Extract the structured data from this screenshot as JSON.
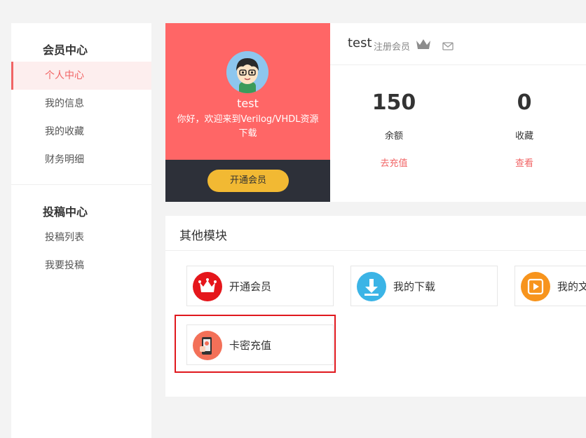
{
  "sidebar": {
    "member_center_title": "会员中心",
    "member_items": [
      "个人中心",
      "我的信息",
      "我的收藏",
      "财务明细"
    ],
    "submission_center_title": "投稿中心",
    "submission_items": [
      "投稿列表",
      "我要投稿"
    ]
  },
  "profile": {
    "name": "test",
    "welcome": "你好，欢迎来到Verilog/VHDL资源下载",
    "vip_button": "开通会员"
  },
  "stats": {
    "username": "test",
    "level": "注册会员",
    "balance_value": "150",
    "balance_label": "余额",
    "balance_link": "去充值",
    "favorites_value": "0",
    "favorites_label": "收藏",
    "favorites_link": "查看"
  },
  "modules": {
    "title": "其他模块",
    "items": [
      {
        "label": "开通会员",
        "icon": "crown-icon",
        "color": "#e5161b"
      },
      {
        "label": "我的下载",
        "icon": "download-icon",
        "color": "#3bb4e6"
      },
      {
        "label": "我的文",
        "icon": "play-icon",
        "color": "#f7941d"
      },
      {
        "label": "卡密充值",
        "icon": "card-recharge-icon",
        "color": "#f37058"
      }
    ]
  },
  "colors": {
    "accent": "#f16465",
    "profile_bg": "#ff6666",
    "profile_dark": "#2d3039",
    "vip_button": "#f2b933",
    "highlight": "#e0181e"
  }
}
